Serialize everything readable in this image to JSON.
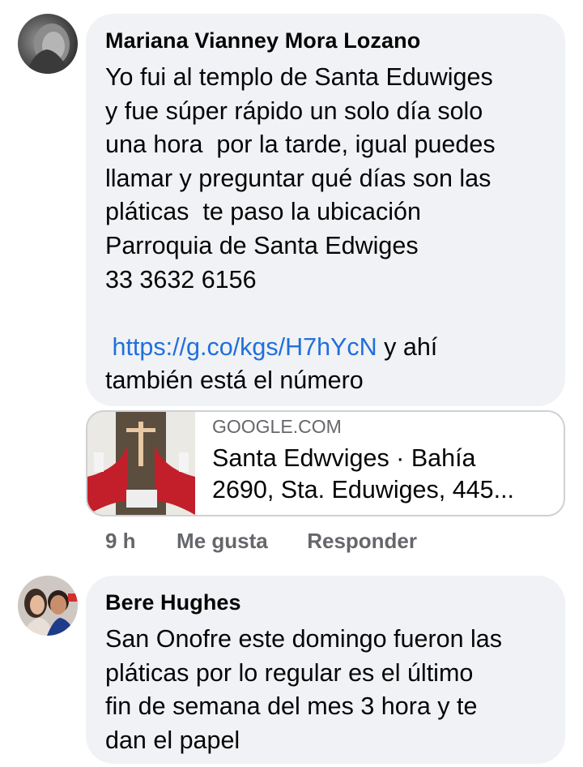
{
  "comments": [
    {
      "author": "Mariana Vianney Mora Lozano",
      "body_lines": [
        "Yo fui al templo de Santa Eduwiges",
        "y fue súper rápido un solo día solo",
        "una hora  por la tarde, igual puedes",
        "llamar y preguntar qué días son las",
        "pláticas  te paso la ubicación",
        "Parroquia de Santa Edwiges",
        "33 3632 6156"
      ],
      "link_text": "https://g.co/kgs/H7hYcN",
      "after_link_1": " y ahí",
      "after_link_2": "también está el número",
      "link_preview": {
        "domain": "GOOGLE.COM",
        "title_line1": "Santa Edwviges · Bahía",
        "title_line2": "2690, Sta. Eduwiges, 445..."
      },
      "actions": {
        "time": "9 h",
        "like": "Me gusta",
        "reply": "Responder"
      }
    },
    {
      "author": "Bere Hughes",
      "body_lines": [
        "San Onofre este domingo fueron las",
        "pláticas por lo regular es el último",
        "fin de semana del mes 3 hora y te",
        "dan el papel"
      ]
    }
  ],
  "colors": {
    "bubble": "#f0f2f5",
    "link": "#216fdb",
    "meta": "#65676b"
  }
}
